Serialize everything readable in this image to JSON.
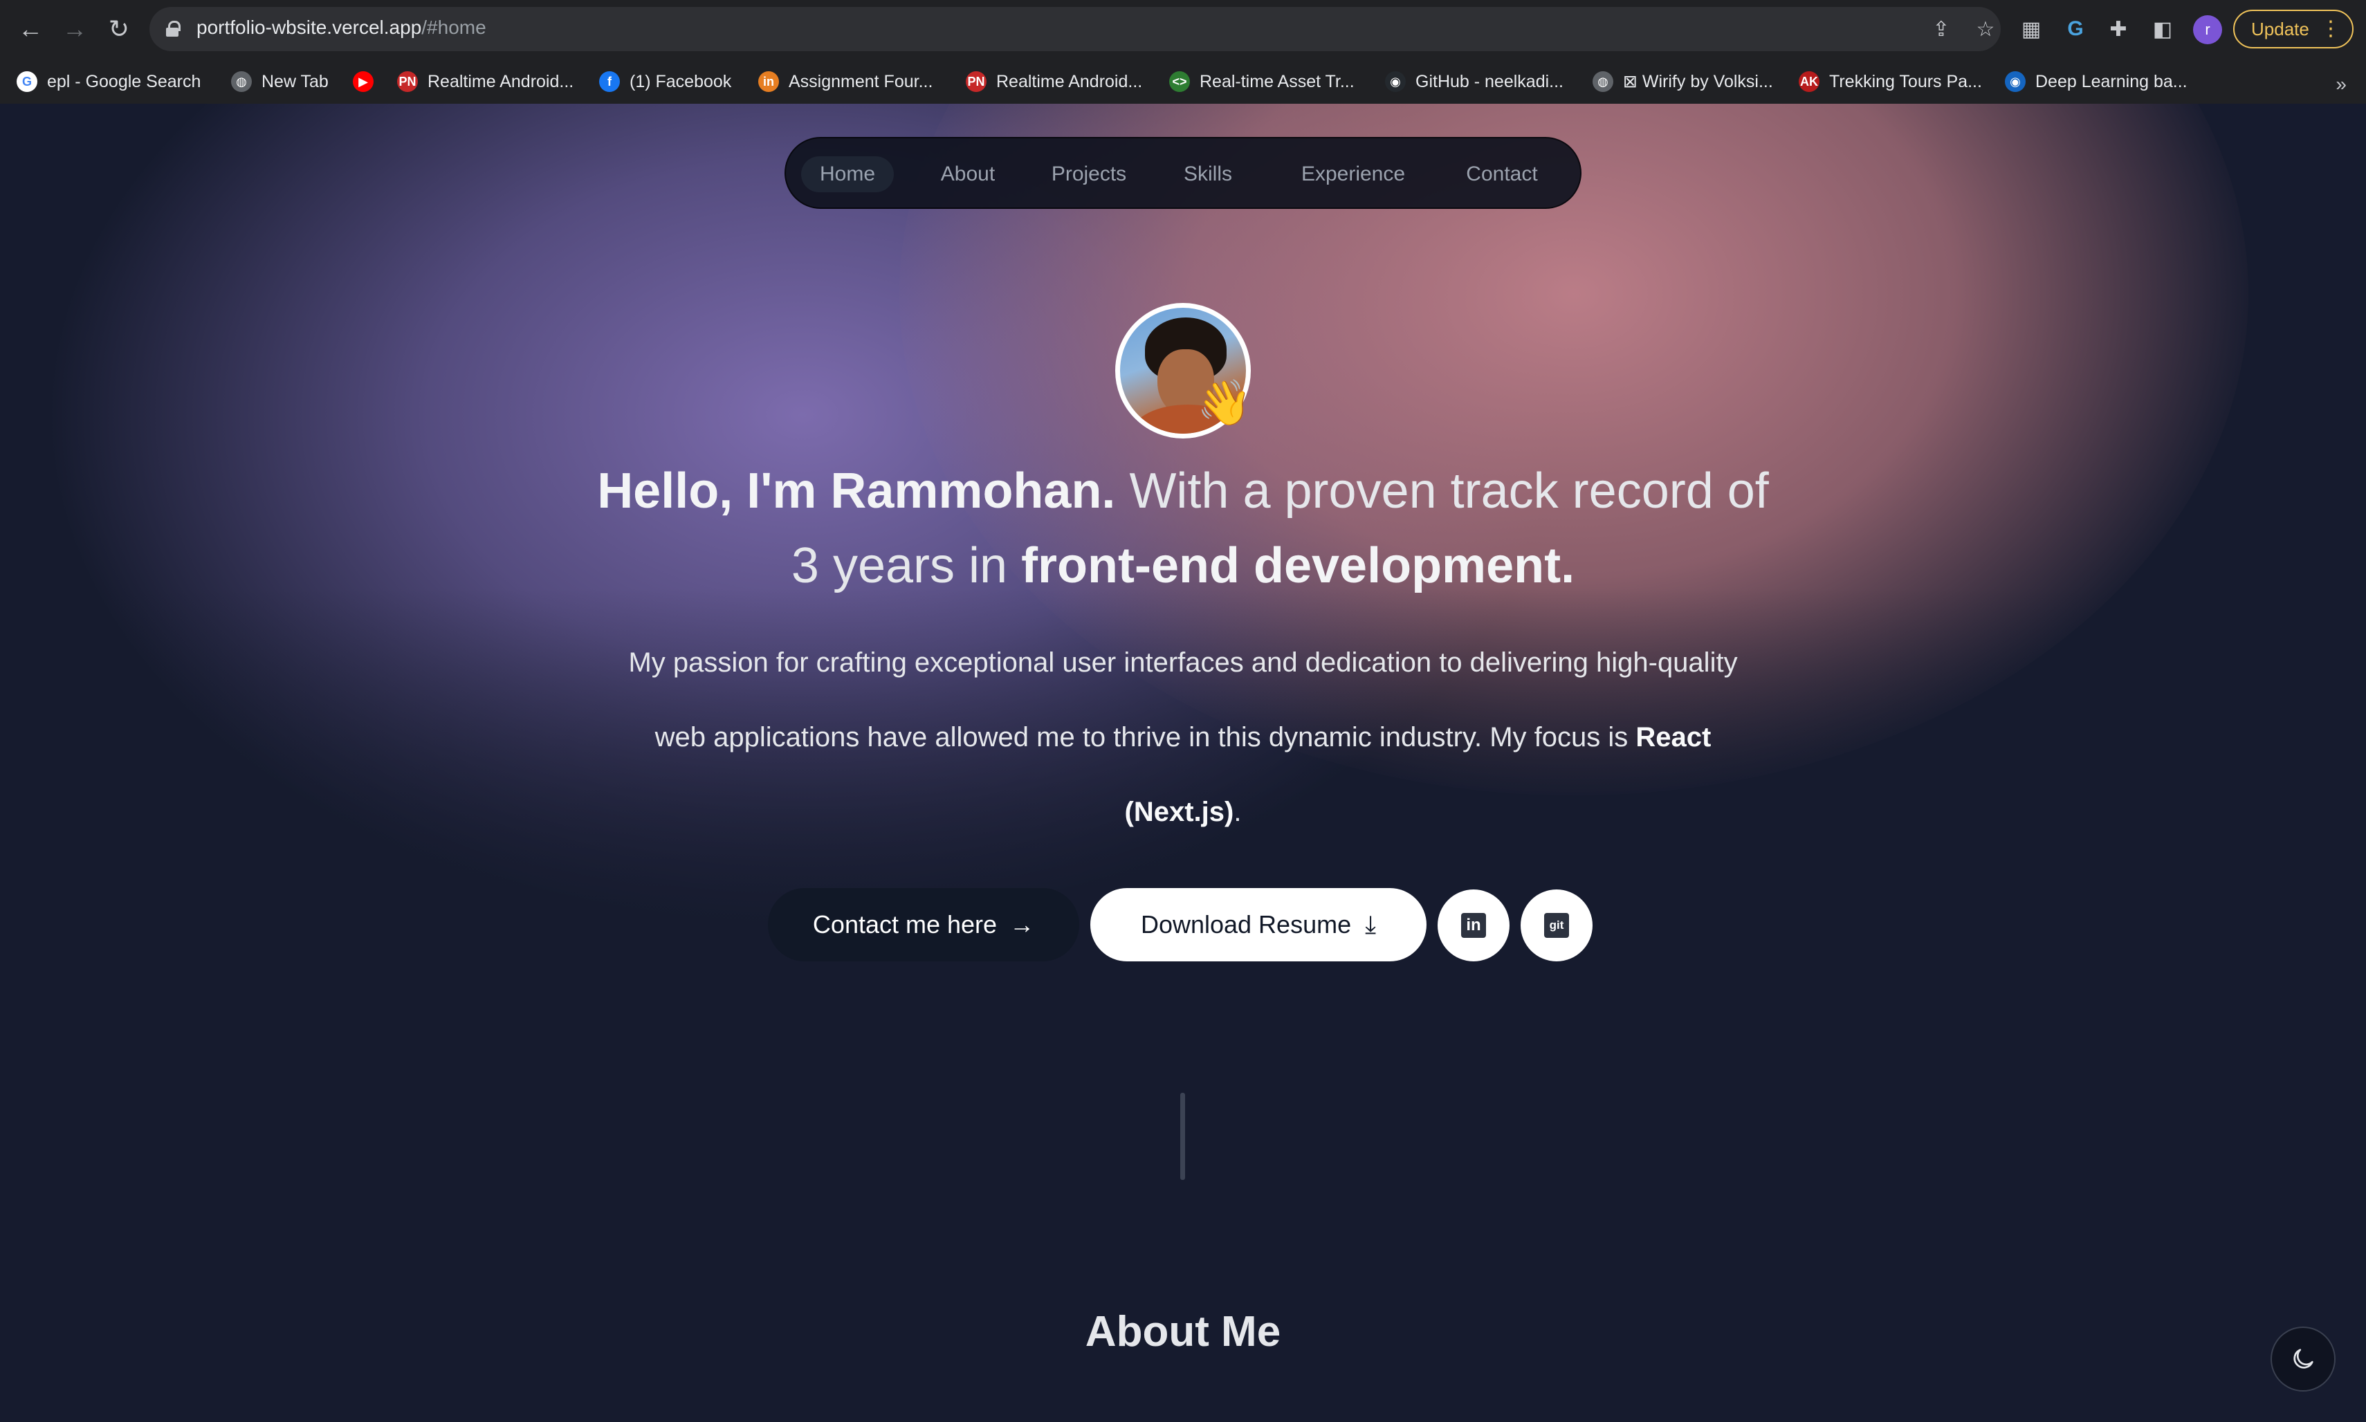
{
  "browser": {
    "url_host": "portfolio-wbsite.vercel.app",
    "url_path": "/#home",
    "update_label": "Update",
    "profile_initial": "r",
    "bookmarks": [
      {
        "label": "epl - Google Search",
        "icon": "google-icon",
        "color": "#ffffff"
      },
      {
        "label": "New Tab",
        "icon": "globe-icon",
        "color": "#5f6368"
      },
      {
        "label": "",
        "icon": "youtube-icon",
        "color": "#ff0000"
      },
      {
        "label": "Realtime Android...",
        "icon": "pn-icon",
        "color": "#c62828"
      },
      {
        "label": "(1) Facebook",
        "icon": "facebook-icon",
        "color": "#1877f2"
      },
      {
        "label": "Assignment Four...",
        "icon": "in-icon",
        "color": "#e67e22"
      },
      {
        "label": "Realtime Android...",
        "icon": "pn-icon",
        "color": "#c62828"
      },
      {
        "label": "Real-time Asset Tr...",
        "icon": "code-icon",
        "color": "#2e7d32"
      },
      {
        "label": "GitHub - neelkadi...",
        "icon": "github-icon",
        "color": "#24292e"
      },
      {
        "label": "⊠ Wirify by Volksi...",
        "icon": "globe-icon",
        "color": "#5f6368"
      },
      {
        "label": "Trekking Tours Pa...",
        "icon": "ak-icon",
        "color": "#b71c1c"
      },
      {
        "label": "Deep Learning ba...",
        "icon": "circle-icon",
        "color": "#1565c0"
      }
    ],
    "more_label": "»"
  },
  "nav": {
    "items": [
      {
        "label": "Home",
        "active": true
      },
      {
        "label": "About",
        "active": false
      },
      {
        "label": "Projects",
        "active": false
      },
      {
        "label": "Skills",
        "active": false
      },
      {
        "label": "Experience",
        "active": false
      },
      {
        "label": "Contact",
        "active": false
      }
    ]
  },
  "hero": {
    "wave_emoji": "👋",
    "headline_bold_1": "Hello, I'm Rammohan.",
    "headline_regular": " With a proven track record of 3 years in ",
    "headline_bold_2": "front-end development.",
    "sub_regular": "My passion for crafting exceptional user interfaces and dedication to delivering high-quality web applications have allowed me to thrive in this dynamic industry. My focus is ",
    "sub_bold": "React (Next.js)",
    "sub_end": ".",
    "contact_label": "Contact me here",
    "contact_arrow": "→",
    "resume_label": "Download Resume",
    "resume_icon": "⤓",
    "linkedin_label": "in",
    "github_label": "git"
  },
  "about": {
    "heading": "About Me"
  },
  "colors": {
    "accent_update": "#f0c35a",
    "page_bg": "#161b2e",
    "nav_bg": "#0f121e"
  }
}
